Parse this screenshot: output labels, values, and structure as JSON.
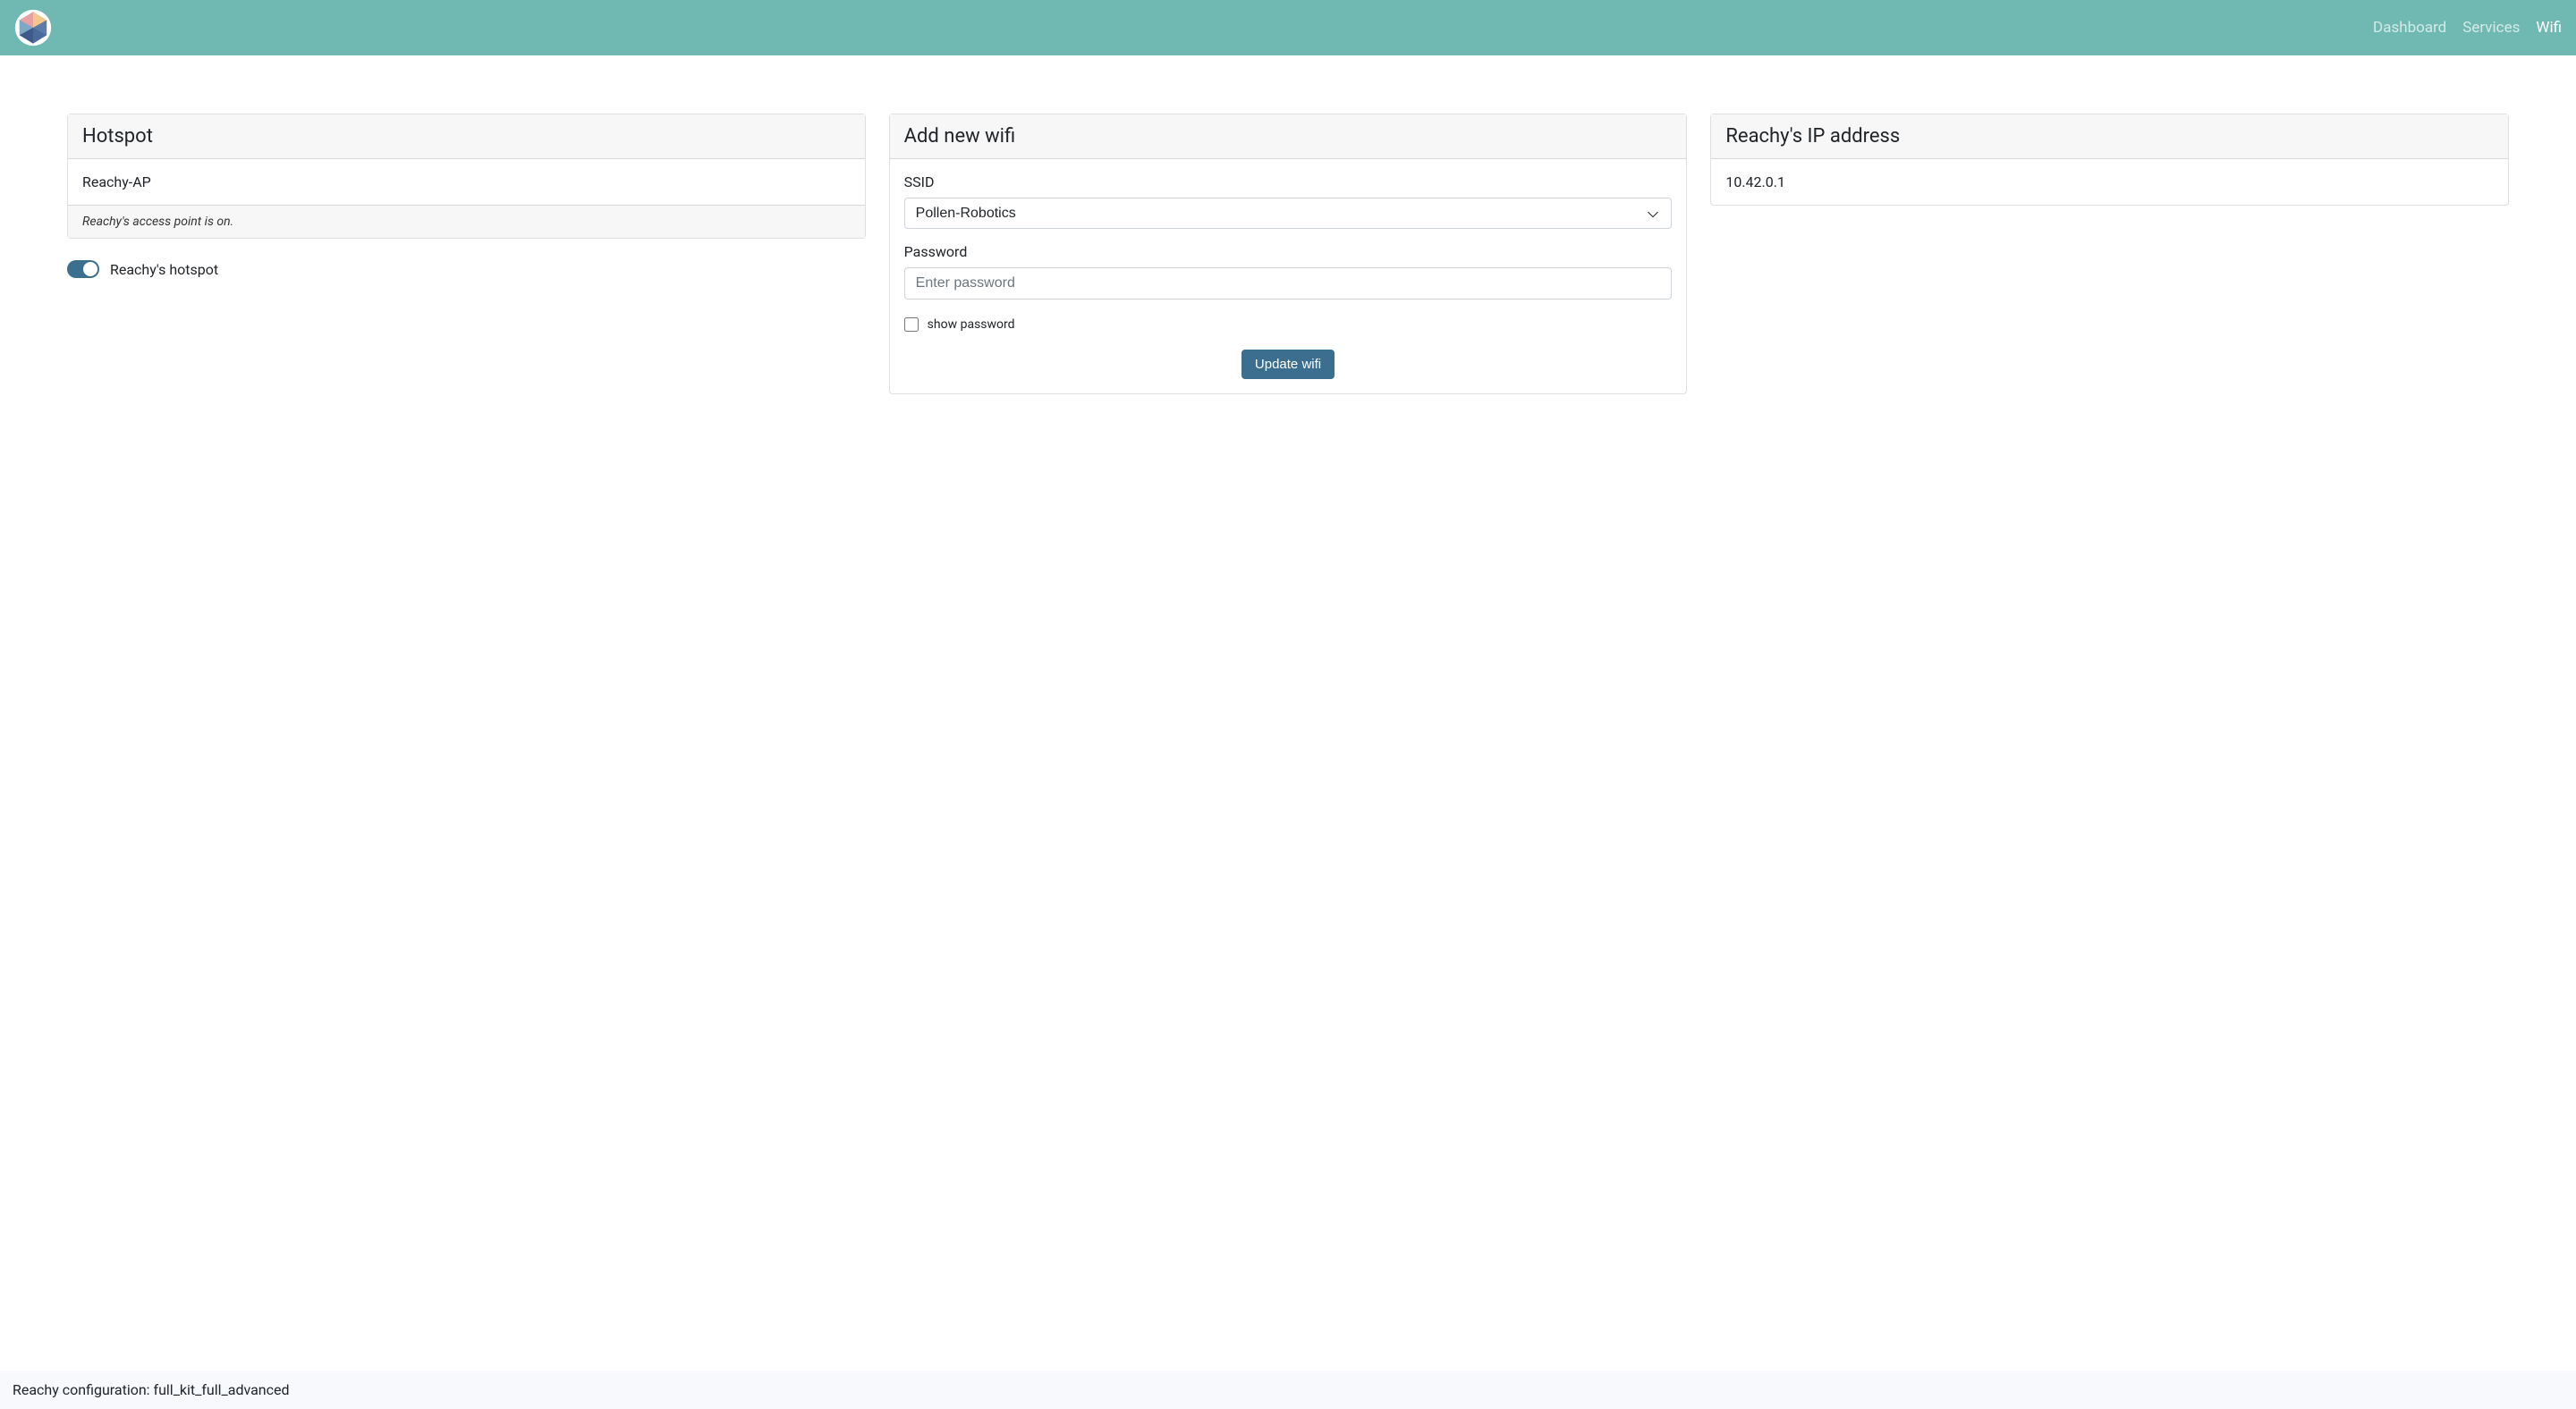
{
  "navbar": {
    "links": [
      {
        "label": "Dashboard",
        "active": false
      },
      {
        "label": "Services",
        "active": false
      },
      {
        "label": "Wifi",
        "active": true
      }
    ]
  },
  "hotspot": {
    "card_title": "Hotspot",
    "network_name": "Reachy-AP",
    "footer_note": "Reachy's access point is on.",
    "toggle_label": "Reachy's hotspot",
    "toggle_on": true
  },
  "wifi_form": {
    "card_title": "Add new wifi",
    "ssid_label": "SSID",
    "ssid_selected": "Pollen-Robotics",
    "password_label": "Password",
    "password_placeholder": "Enter password",
    "show_password_label": "show password",
    "submit_label": "Update wifi"
  },
  "ip_card": {
    "card_title": "Reachy's IP address",
    "ip_value": "10.42.0.1"
  },
  "footer": {
    "text": "Reachy configuration: full_kit_full_advanced"
  }
}
